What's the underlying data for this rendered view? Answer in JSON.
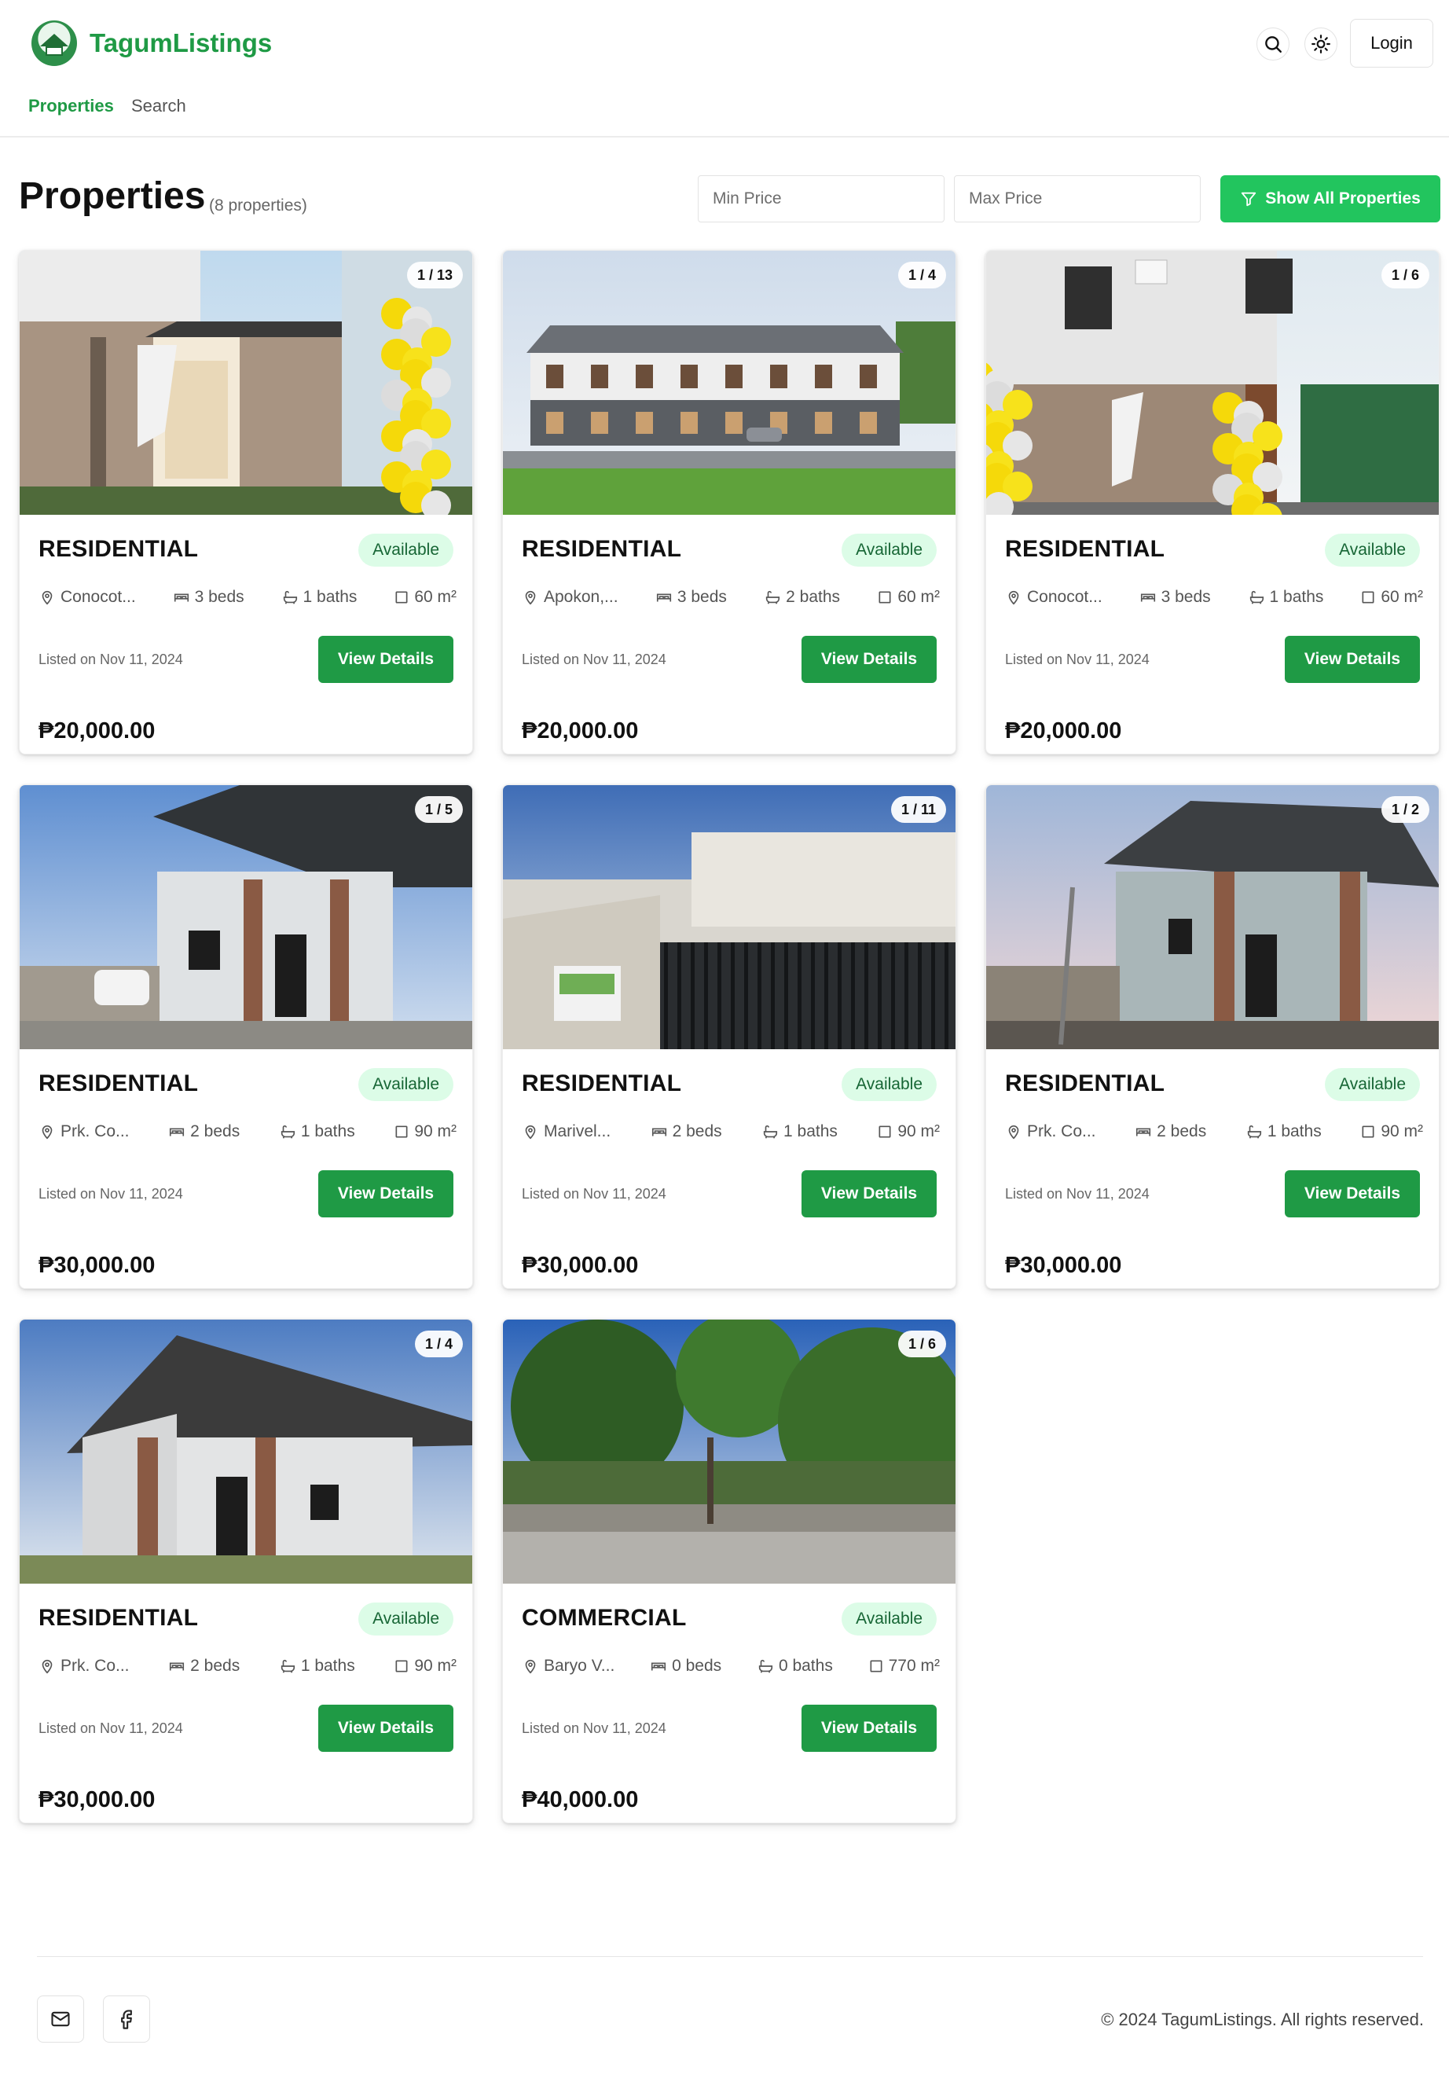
{
  "header": {
    "brand": "TagumListings",
    "nav": {
      "properties": "Properties",
      "search": "Search"
    },
    "login": "Login",
    "colors": {
      "brand": "#1f9a45",
      "accent": "#22c55e"
    }
  },
  "page": {
    "title": "Properties",
    "count_text": "(8 properties)",
    "min_price_placeholder": "Min Price",
    "max_price_placeholder": "Max Price",
    "show_all": "Show All Properties"
  },
  "cards": [
    {
      "counter": "1 / 13",
      "type": "RESIDENTIAL",
      "status": "Available",
      "location": "Conocot...",
      "beds": "3 beds",
      "baths": "1 baths",
      "area": "60 m²",
      "listed": "Listed on Nov 11, 2024",
      "button": "View Details",
      "price": "₱20,000.00"
    },
    {
      "counter": "1 / 4",
      "type": "RESIDENTIAL",
      "status": "Available",
      "location": "Apokon,...",
      "beds": "3 beds",
      "baths": "2 baths",
      "area": "60 m²",
      "listed": "Listed on Nov 11, 2024",
      "button": "View Details",
      "price": "₱20,000.00"
    },
    {
      "counter": "1 / 6",
      "type": "RESIDENTIAL",
      "status": "Available",
      "location": "Conocot...",
      "beds": "3 beds",
      "baths": "1 baths",
      "area": "60 m²",
      "listed": "Listed on Nov 11, 2024",
      "button": "View Details",
      "price": "₱20,000.00"
    },
    {
      "counter": "1 / 5",
      "type": "RESIDENTIAL",
      "status": "Available",
      "location": "Prk. Co...",
      "beds": "2 beds",
      "baths": "1 baths",
      "area": "90 m²",
      "listed": "Listed on Nov 11, 2024",
      "button": "View Details",
      "price": "₱30,000.00"
    },
    {
      "counter": "1 / 11",
      "type": "RESIDENTIAL",
      "status": "Available",
      "location": "Marivel...",
      "beds": "2 beds",
      "baths": "1 baths",
      "area": "90 m²",
      "listed": "Listed on Nov 11, 2024",
      "button": "View Details",
      "price": "₱30,000.00"
    },
    {
      "counter": "1 / 2",
      "type": "RESIDENTIAL",
      "status": "Available",
      "location": "Prk. Co...",
      "beds": "2 beds",
      "baths": "1 baths",
      "area": "90 m²",
      "listed": "Listed on Nov 11, 2024",
      "button": "View Details",
      "price": "₱30,000.00"
    },
    {
      "counter": "1 / 4",
      "type": "RESIDENTIAL",
      "status": "Available",
      "location": "Prk. Co...",
      "beds": "2 beds",
      "baths": "1 baths",
      "area": "90 m²",
      "listed": "Listed on Nov 11, 2024",
      "button": "View Details",
      "price": "₱30,000.00"
    },
    {
      "counter": "1 / 6",
      "type": "COMMERCIAL",
      "status": "Available",
      "location": "Baryo V...",
      "beds": "0 beds",
      "baths": "0 baths",
      "area": "770 m²",
      "listed": "Listed on Nov 11, 2024",
      "button": "View Details",
      "price": "₱40,000.00"
    }
  ],
  "footer": {
    "copyright": "© 2024 TagumListings. All rights reserved.",
    "icons": [
      "mail-icon",
      "facebook-icon"
    ]
  }
}
